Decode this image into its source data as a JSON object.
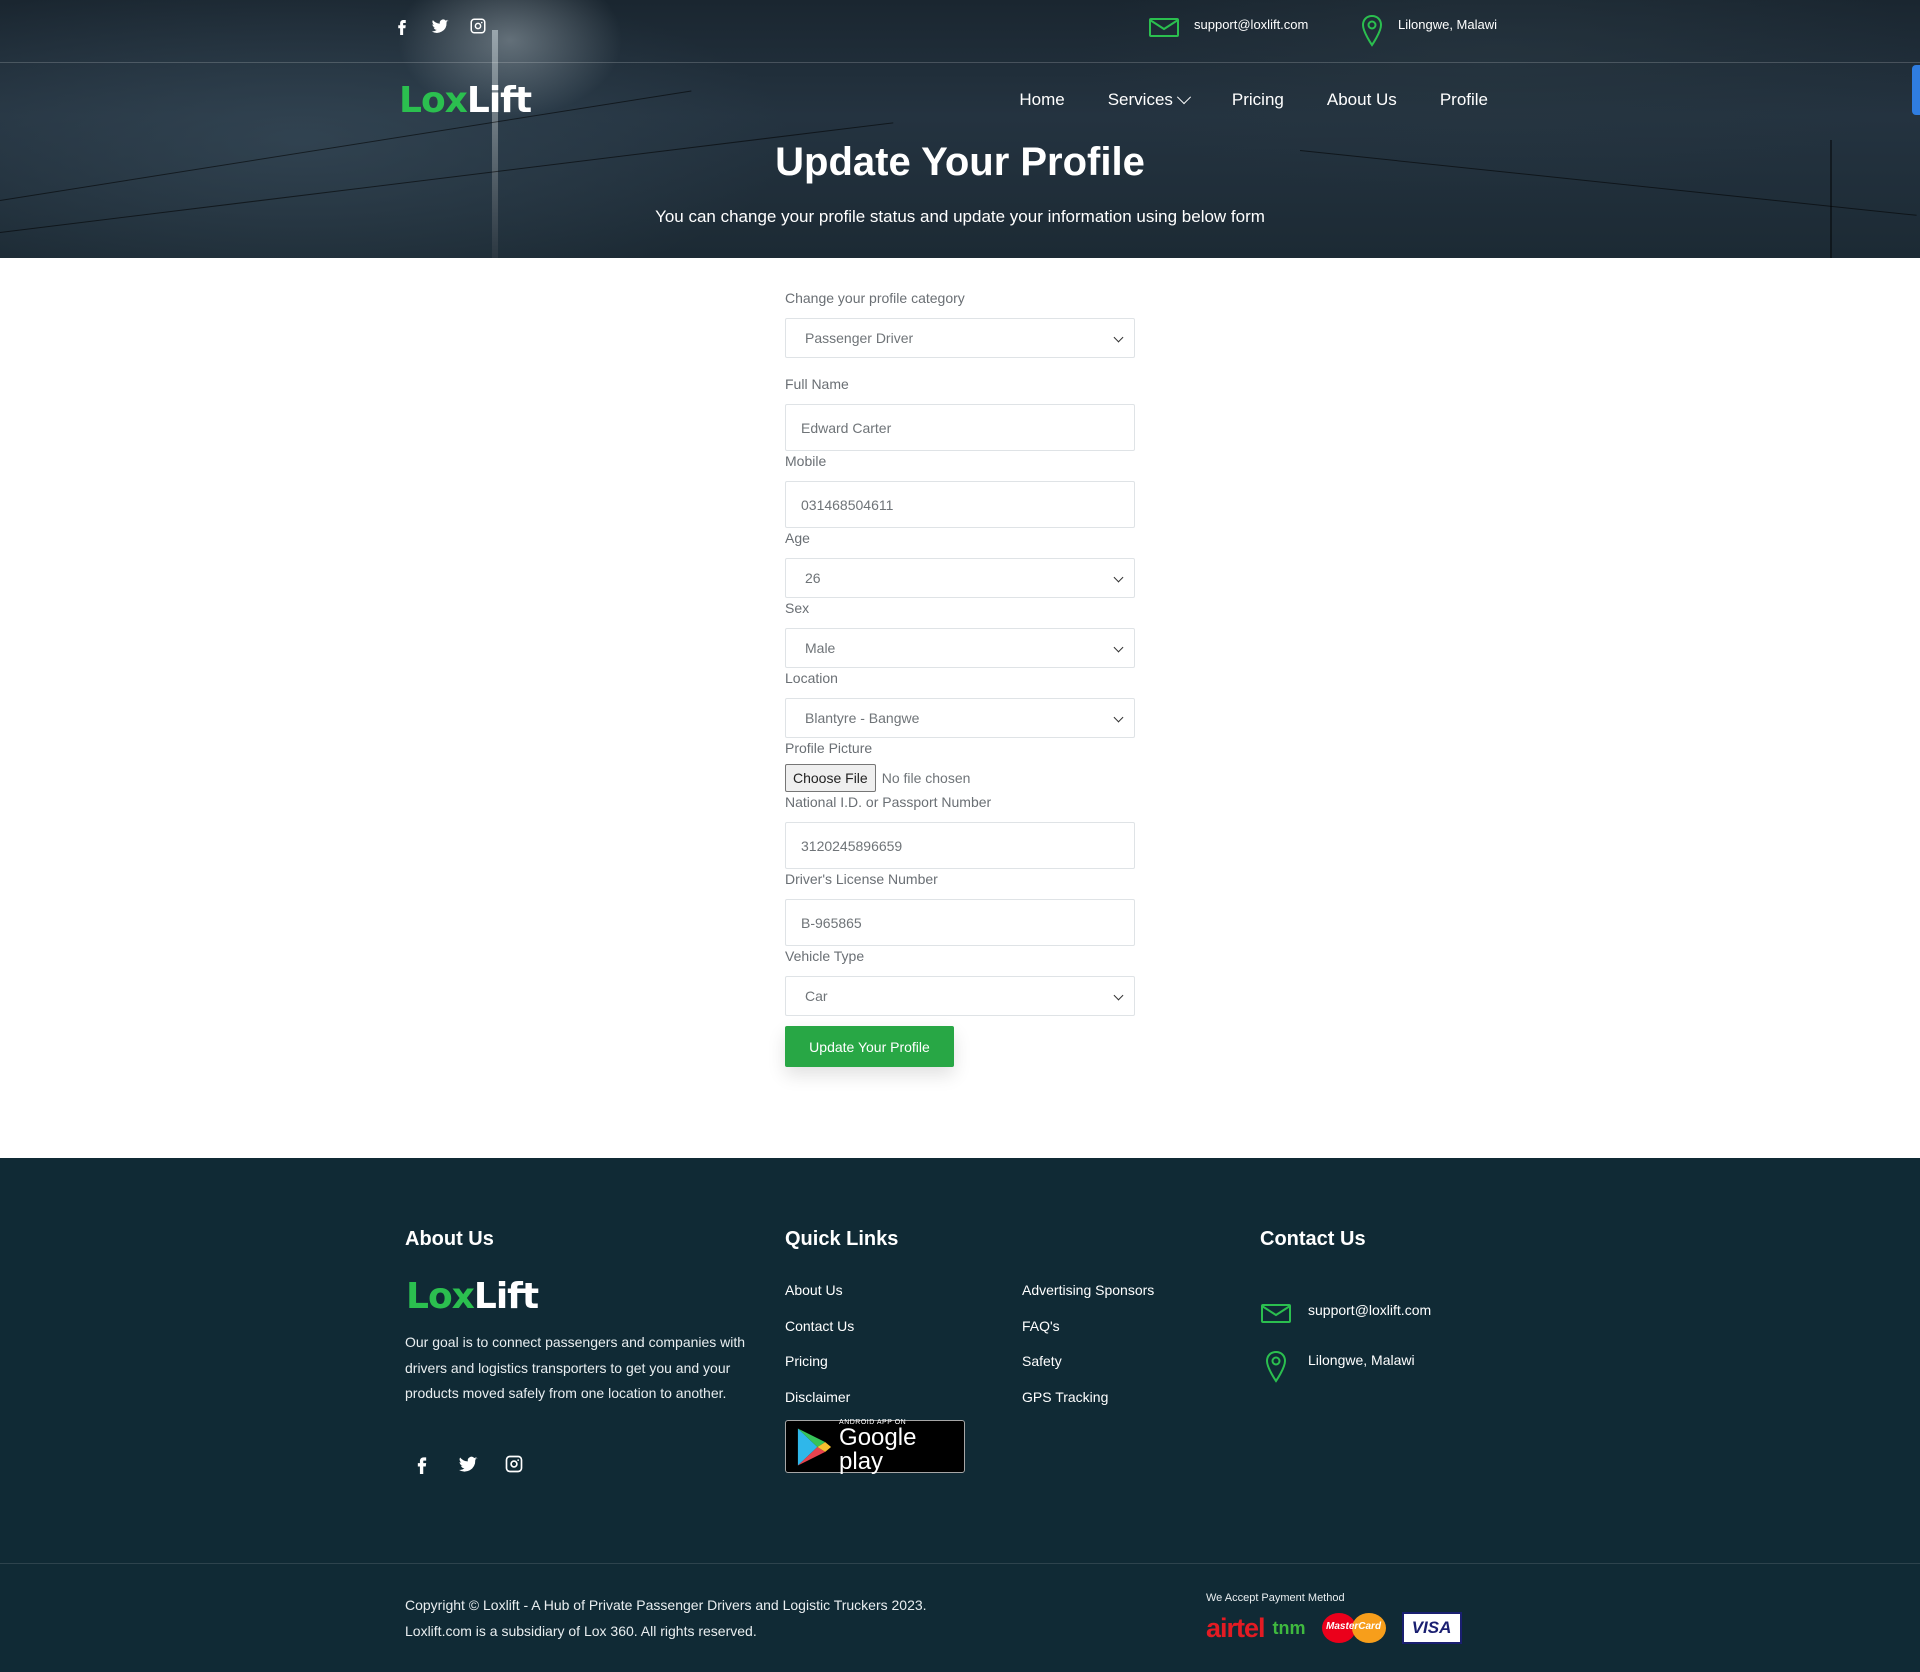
{
  "header": {
    "email": "support@loxlift.com",
    "location": "Lilongwe, Malawi",
    "logo": {
      "part1": "Lox",
      "part2": "Lift"
    },
    "nav": [
      "Home",
      "Services",
      "Pricing",
      "About Us",
      "Profile"
    ],
    "title": "Update Your Profile",
    "subtitle": "You can change your profile status and update your information using below form"
  },
  "form": {
    "category_label": "Change your profile category",
    "category_value": "Passenger Driver",
    "fullname_label": "Full Name",
    "fullname_value": "Edward Carter",
    "mobile_label": "Mobile",
    "mobile_value": "031468504611",
    "age_label": "Age",
    "age_value": "26",
    "sex_label": "Sex",
    "sex_value": "Male",
    "location_label": "Location",
    "location_value": "Blantyre - Bangwe",
    "picture_label": "Profile Picture",
    "file_button": "Choose File",
    "file_status": "No file chosen",
    "nid_label": "National I.D. or Passport Number",
    "nid_value": "3120245896659",
    "license_label": "Driver's License Number",
    "license_value": "B-965865",
    "vehicle_label": "Vehicle Type",
    "vehicle_value": "Car",
    "submit": "Update Your Profile"
  },
  "footer": {
    "about_title": "About Us",
    "about_text": "Our goal is to connect passengers and companies with drivers and logistics transporters to get you and your products moved safely from one location to another.",
    "quick_title": "Quick Links",
    "links_col1": [
      "About Us",
      "Contact Us",
      "Pricing",
      "Disclaimer"
    ],
    "links_col2": [
      "Advertising Sponsors",
      "FAQ's",
      "Safety",
      "GPS Tracking"
    ],
    "gplay_small": "ANDROID APP ON",
    "gplay_big": "Google play",
    "contact_title": "Contact Us",
    "email": "support@loxlift.com",
    "location": "Lilongwe, Malawi",
    "copyright_line1": "Copyright © Loxlift - A Hub of Private Passenger Drivers and Logistic Truckers 2023.",
    "copyright_line2": "Loxlift.com is a subsidiary of Lox 360. All rights reserved.",
    "payment_title": "We Accept Payment Method",
    "payments": [
      "airtel",
      "tnm",
      "MasterCard",
      "VISA"
    ]
  },
  "colors": {
    "brand_green": "#2bbf4f",
    "button_green": "#28a745",
    "footer_bg": "#102a35"
  }
}
